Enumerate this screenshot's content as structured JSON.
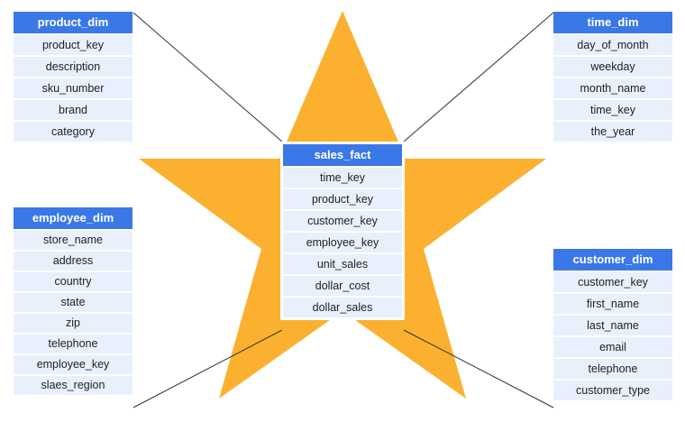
{
  "colors": {
    "star": "#fbb12f",
    "header": "#3b78e7",
    "row": "#e8f0fe",
    "line": "#333333"
  },
  "product_dim": {
    "title": "product_dim",
    "fields": [
      "product_key",
      "description",
      "sku_number",
      "brand",
      "category"
    ]
  },
  "time_dim": {
    "title": "time_dim",
    "fields": [
      "day_of_month",
      "weekday",
      "month_name",
      "time_key",
      "the_year"
    ]
  },
  "employee_dim": {
    "title": "employee_dim",
    "fields": [
      "store_name",
      "address",
      "country",
      "state",
      "zip",
      "telephone",
      "employee_key",
      "slaes_region"
    ]
  },
  "customer_dim": {
    "title": "customer_dim",
    "fields": [
      "customer_key",
      "first_name",
      "last_name",
      "email",
      "telephone",
      "customer_type"
    ]
  },
  "sales_fact": {
    "title": "sales_fact",
    "fields": [
      "time_key",
      "product_key",
      "customer_key",
      "employee_key",
      "unit_sales",
      "dollar_cost",
      "dollar_sales"
    ]
  }
}
